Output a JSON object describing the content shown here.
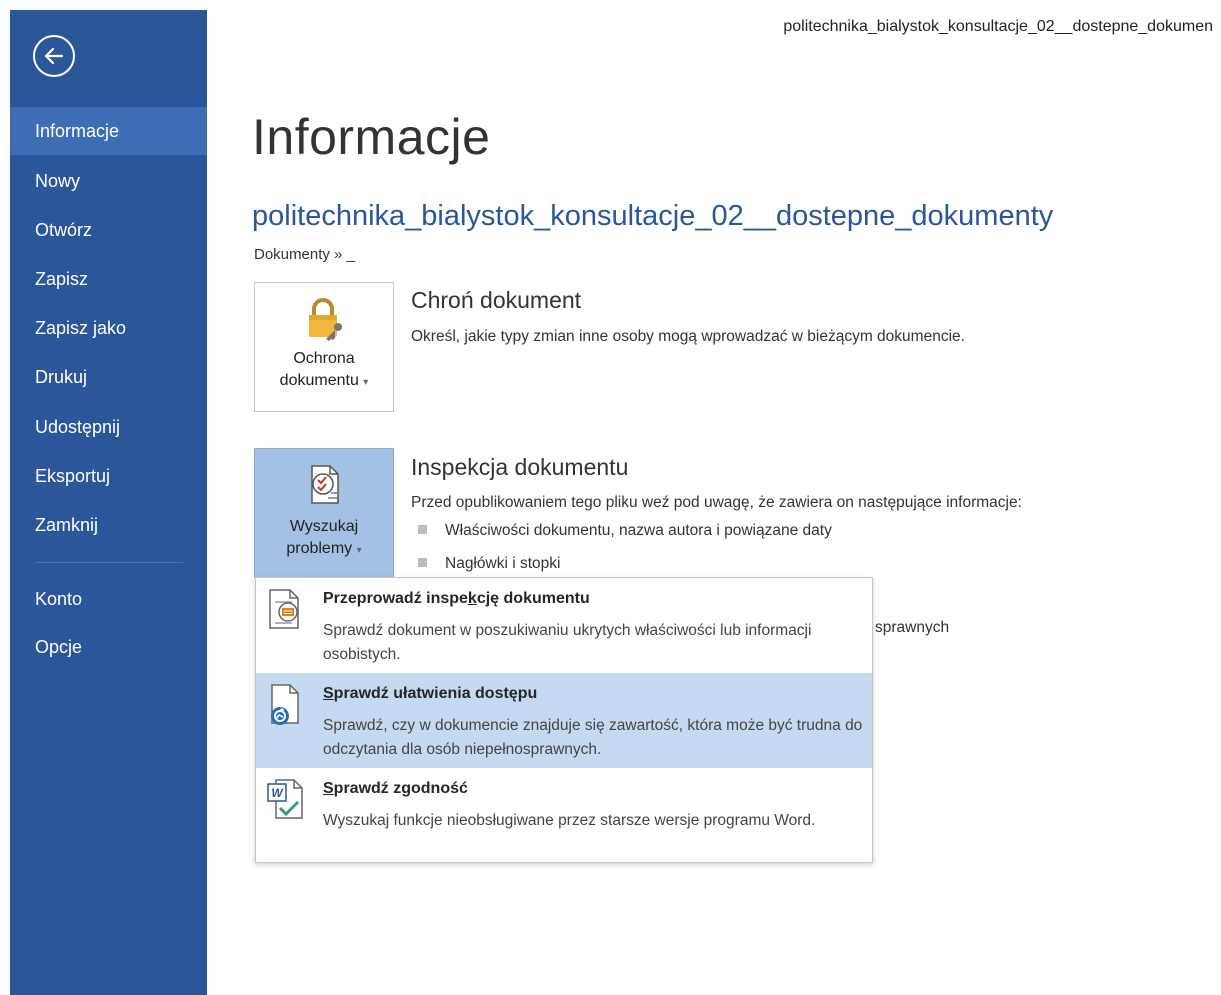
{
  "window": {
    "filename": "politechnika_bialystok_konsultacje_02__dostepne_dokumen"
  },
  "sidebar": {
    "items": [
      {
        "label": "Informacje",
        "active": true
      },
      {
        "label": "Nowy"
      },
      {
        "label": "Otwórz"
      },
      {
        "label": "Zapisz"
      },
      {
        "label": "Zapisz jako"
      },
      {
        "label": "Drukuj"
      },
      {
        "label": "Udostępnij"
      },
      {
        "label": "Eksportuj"
      },
      {
        "label": "Zamknij"
      }
    ],
    "bottom_items": [
      {
        "label": "Konto"
      },
      {
        "label": "Opcje"
      }
    ],
    "color": "#2b579a",
    "active_color": "#3e6db5"
  },
  "main": {
    "title": "Informacje",
    "doc_title": "politechnika_bialystok_konsultacje_02__dostepne_dokumenty",
    "breadcrumb": "Dokumenty » _",
    "protect": {
      "button_line1": "Ochrona",
      "button_line2": "dokumentu",
      "title": "Chroń dokument",
      "desc": "Określ, jakie typy zmian inne osoby mogą wprowadzać w bieżącym dokumencie."
    },
    "inspect": {
      "button_line1": "Wyszukaj",
      "button_line2": "problemy",
      "title": "Inspekcja dokumentu",
      "desc": "Przed opublikowaniem tego pliku weź pod uwagę, że zawiera on następujące informacje:",
      "bullets": [
        "Właściwości dokumentu, nazwa autora i powiązane daty",
        "Nagłówki i stopki"
      ],
      "partial_text": "sprawnych"
    }
  },
  "dropdown": {
    "items": [
      {
        "title_pre": "Przeprowadź inspe",
        "title_ul": "k",
        "title_post": "cję dokumentu",
        "desc": "Sprawdź dokument w poszukiwaniu ukrytych właściwości lub informacji osobistych."
      },
      {
        "title_pre": "",
        "title_ul": "S",
        "title_post": "prawdź ułatwienia dostępu",
        "desc": "Sprawdź, czy w dokumencie znajduje się zawartość, która może być trudna do odczytania dla osób niepełnosprawnych.",
        "highlighted": true
      },
      {
        "title_pre": "",
        "title_ul": "S",
        "title_post": "prawdź zgodność",
        "desc": "Wyszukaj funkcje nieobsługiwane przez starsze wersje programu Word."
      }
    ],
    "highlight_color": "#c5d9f1"
  },
  "icons": {
    "back": "back-arrow-icon",
    "protect": "lock-key-icon",
    "inspect": "checklist-icon",
    "inspect_doc": "inspect-document-icon",
    "accessibility": "accessibility-check-icon",
    "compat": "word-compatibility-icon"
  }
}
